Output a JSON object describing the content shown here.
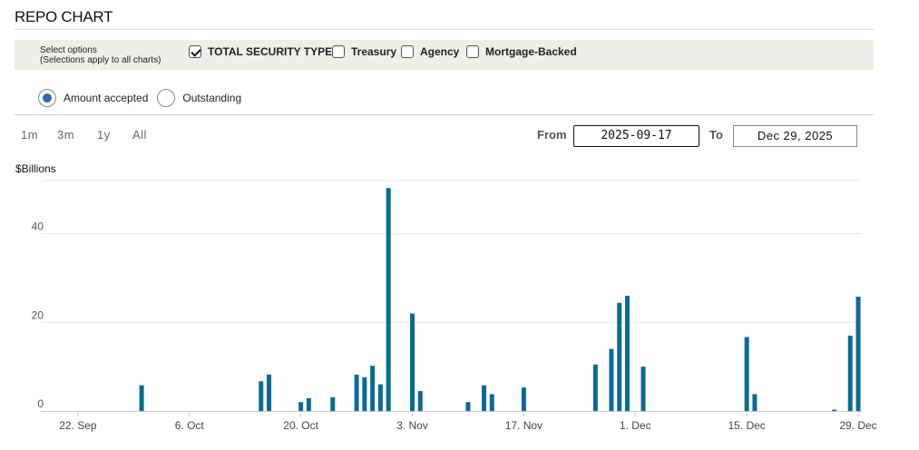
{
  "page_title": "REPO CHART",
  "options": {
    "note_line1": "Select options",
    "note_line2": "(Selections apply to all charts)",
    "checkboxes": [
      {
        "label": "TOTAL SECURITY TYPES",
        "checked": true
      },
      {
        "label": "Treasury",
        "checked": false
      },
      {
        "label": "Agency",
        "checked": false
      },
      {
        "label": "Mortgage-Backed",
        "checked": false
      }
    ]
  },
  "radios": [
    {
      "label": "Amount accepted",
      "selected": true
    },
    {
      "label": "Outstanding",
      "selected": false
    }
  ],
  "range_buttons": [
    "1m",
    "3m",
    "1y",
    "All"
  ],
  "date_range": {
    "from_label": "From",
    "from_value": "2025-09-17",
    "to_label": "To",
    "to_value": "Dec 29, 2025"
  },
  "accent_color": "#0b6a97",
  "chart_data": {
    "type": "bar",
    "ylabel": "$Billions",
    "ylim": [
      0,
      52
    ],
    "yticks": [
      0,
      20,
      40
    ],
    "x_tick_labels": [
      "22. Sep",
      "6. Oct",
      "20. Oct",
      "3. Nov",
      "17. Nov",
      "1. Dec",
      "15. Dec",
      "29. Dec"
    ],
    "x_tick_dates": [
      "2025-09-22",
      "2025-10-06",
      "2025-10-20",
      "2025-11-03",
      "2025-11-17",
      "2025-12-01",
      "2025-12-15",
      "2025-12-29"
    ],
    "x_range": [
      "2025-09-17",
      "2025-12-29"
    ],
    "grid": true,
    "series": [
      {
        "color": "#0b6a97",
        "points": [
          {
            "x": "2025-09-30",
            "y": 5.8
          },
          {
            "x": "2025-10-15",
            "y": 6.7
          },
          {
            "x": "2025-10-16",
            "y": 8.2
          },
          {
            "x": "2025-10-20",
            "y": 2.0
          },
          {
            "x": "2025-10-21",
            "y": 2.9
          },
          {
            "x": "2025-10-24",
            "y": 3.1
          },
          {
            "x": "2025-10-27",
            "y": 8.2
          },
          {
            "x": "2025-10-28",
            "y": 7.6
          },
          {
            "x": "2025-10-29",
            "y": 10.2
          },
          {
            "x": "2025-10-30",
            "y": 6.0
          },
          {
            "x": "2025-10-31",
            "y": 50.3
          },
          {
            "x": "2025-11-03",
            "y": 22.0
          },
          {
            "x": "2025-11-04",
            "y": 4.5
          },
          {
            "x": "2025-11-10",
            "y": 2.0
          },
          {
            "x": "2025-11-12",
            "y": 5.8
          },
          {
            "x": "2025-11-13",
            "y": 3.8
          },
          {
            "x": "2025-11-17",
            "y": 5.3
          },
          {
            "x": "2025-11-26",
            "y": 10.5
          },
          {
            "x": "2025-11-28",
            "y": 14.0
          },
          {
            "x": "2025-11-29",
            "y": 24.4
          },
          {
            "x": "2025-11-30",
            "y": 26.0
          },
          {
            "x": "2025-12-02",
            "y": 10.0
          },
          {
            "x": "2025-12-15",
            "y": 16.7
          },
          {
            "x": "2025-12-16",
            "y": 3.8
          },
          {
            "x": "2025-12-26",
            "y": 0.3
          },
          {
            "x": "2025-12-28",
            "y": 17.0
          },
          {
            "x": "2025-12-29",
            "y": 25.8
          }
        ]
      }
    ]
  }
}
